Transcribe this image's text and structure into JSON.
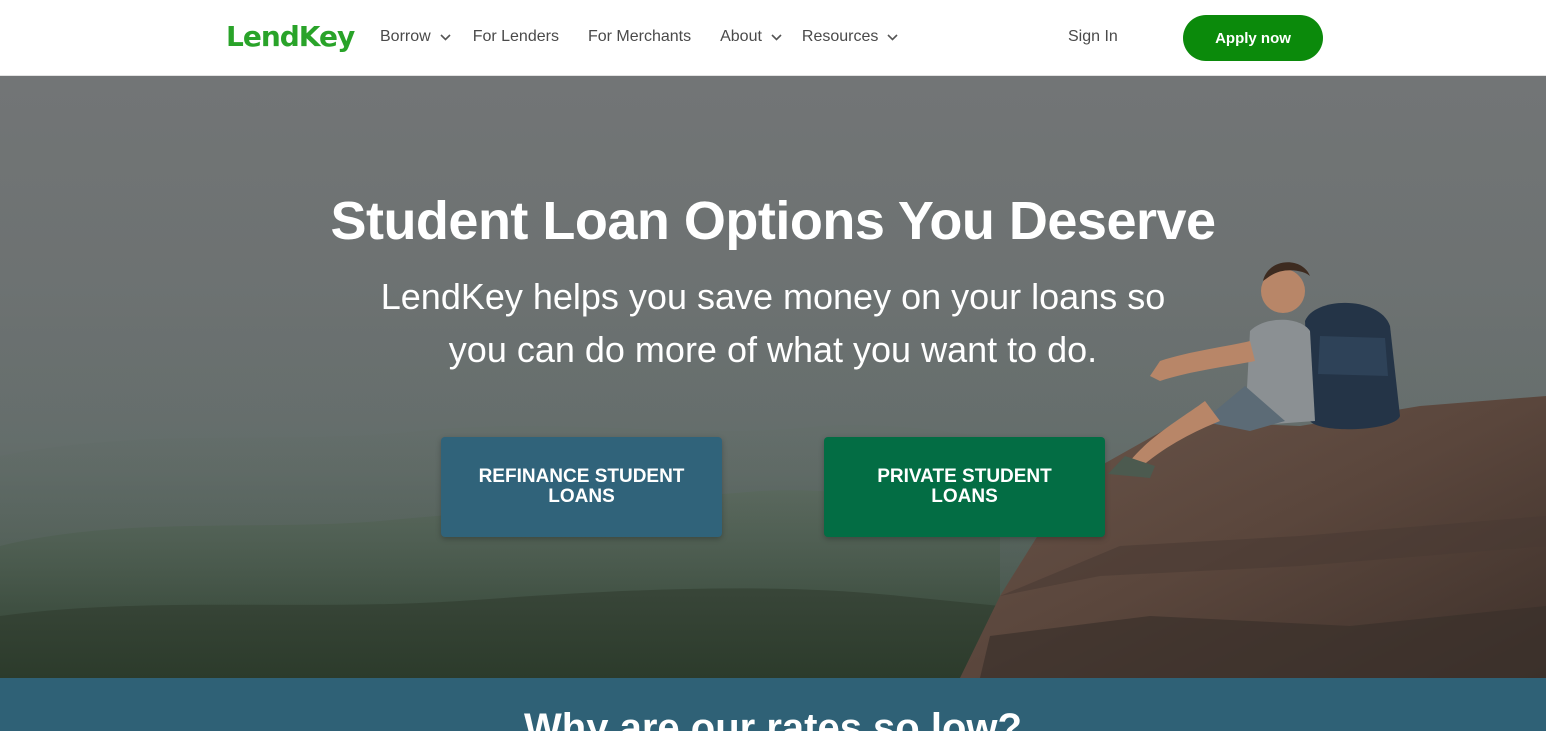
{
  "brand": {
    "logo_text": "LendKey",
    "primary_green": "#0b8a0b",
    "logo_green": "#29a329",
    "teal": "#30637a",
    "dark_green": "#036d44"
  },
  "nav": {
    "items": [
      {
        "label": "Borrow",
        "has_dropdown": true
      },
      {
        "label": "For Lenders",
        "has_dropdown": false
      },
      {
        "label": "For Merchants",
        "has_dropdown": false
      },
      {
        "label": "About",
        "has_dropdown": true
      },
      {
        "label": "Resources",
        "has_dropdown": true
      }
    ],
    "sign_in": "Sign In",
    "apply": "Apply now"
  },
  "hero": {
    "title": "Student Loan Options You Deserve",
    "subtitle": "LendKey helps you save money on your loans so you can do more of what you want to do.",
    "buttons": [
      {
        "label": "REFINANCE STUDENT LOANS",
        "color": "#30637a"
      },
      {
        "label": "PRIVATE STUDENT LOANS",
        "color": "#036d44"
      }
    ]
  },
  "next_section": {
    "title": "Why are our rates so low?"
  }
}
